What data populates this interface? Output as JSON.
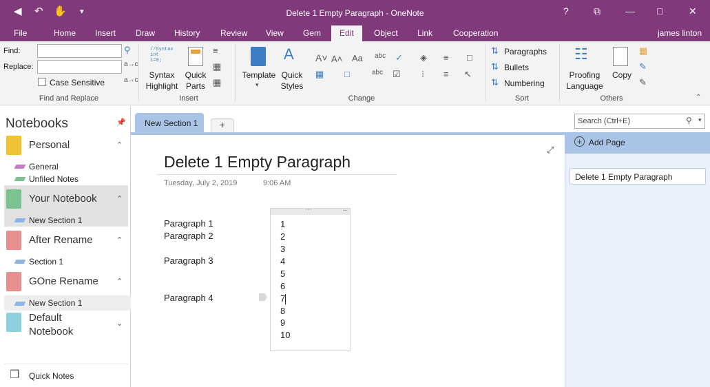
{
  "window": {
    "title": "Delete 1 Empty Paragraph - OneNote",
    "help": "?",
    "restore_ribbon": "⧉",
    "minimize": "—",
    "maximize": "□",
    "close": "✕"
  },
  "quick_access": [
    "back-icon",
    "undo-icon",
    "touch-mode-icon",
    "customize-icon"
  ],
  "tabs": [
    "File",
    "Home",
    "Insert",
    "Draw",
    "History",
    "Review",
    "View",
    "Gem",
    "Edit",
    "Object",
    "Link",
    "Cooperation"
  ],
  "active_tab": "Edit",
  "user": "james linton",
  "ribbon": {
    "find_replace": {
      "find_label": "Find:",
      "replace_label": "Replace:",
      "find_value": "",
      "replace_value": "",
      "case_label": "Case Sensitive",
      "group": "Find and Replace"
    },
    "insert": {
      "syntax_label": "Syntax",
      "syntax_label2": "Highlight",
      "quick_label": "Quick",
      "quick_label2": "Parts",
      "group": "Insert"
    },
    "change": {
      "template_label": "Template",
      "quick_styles_label": "Quick",
      "quick_styles_label2": "Styles",
      "group": "Change"
    },
    "sort": {
      "paragraphs": "Paragraphs",
      "bullets": "Bullets",
      "numbering": "Numbering",
      "group": "Sort"
    },
    "others": {
      "proofing": "Proofing",
      "proofing2": "Language",
      "copy": "Copy",
      "group": "Others"
    }
  },
  "navigation": {
    "header": "Notebooks",
    "notebooks": [
      {
        "name": "Personal",
        "color": "#f1c232",
        "sections": [
          {
            "name": "General",
            "color": "#c67cc2"
          },
          {
            "name": "Unfiled Notes",
            "color": "#7ac38f"
          }
        ]
      },
      {
        "name": "Your Notebook",
        "color": "#7ac38f",
        "sections": [
          {
            "name": "New Section 1",
            "color": "#8eb4e3"
          }
        ]
      },
      {
        "name": "After Rename",
        "color": "#e88f8f",
        "sections": [
          {
            "name": "Section 1",
            "color": "#8eb4e3"
          }
        ]
      },
      {
        "name": "GOne Rename",
        "color": "#e88f8f",
        "sections": [
          {
            "name": "New Section 1",
            "color": "#8eb4e3"
          }
        ]
      },
      {
        "name": "Default Notebook",
        "color": "#8fd0e0",
        "sections": []
      }
    ],
    "quick_notes": "Quick Notes"
  },
  "section_tabs": {
    "active": "New Section 1",
    "add": "+"
  },
  "page": {
    "title": "Delete 1 Empty Paragraph",
    "date": "Tuesday, July 2, 2019",
    "time": "9:06 AM",
    "paragraphs": [
      "Paragraph 1",
      "Paragraph 2",
      "Paragraph 3",
      "Paragraph 4"
    ],
    "numbers": [
      "1",
      "2",
      "3",
      "4",
      "5",
      "6",
      "7",
      "8",
      "9",
      "10"
    ]
  },
  "pages_pane": {
    "search_placeholder": "Search (Ctrl+E)",
    "add_page": "Add Page",
    "pages": [
      "Delete 1 Empty Paragraph"
    ]
  }
}
